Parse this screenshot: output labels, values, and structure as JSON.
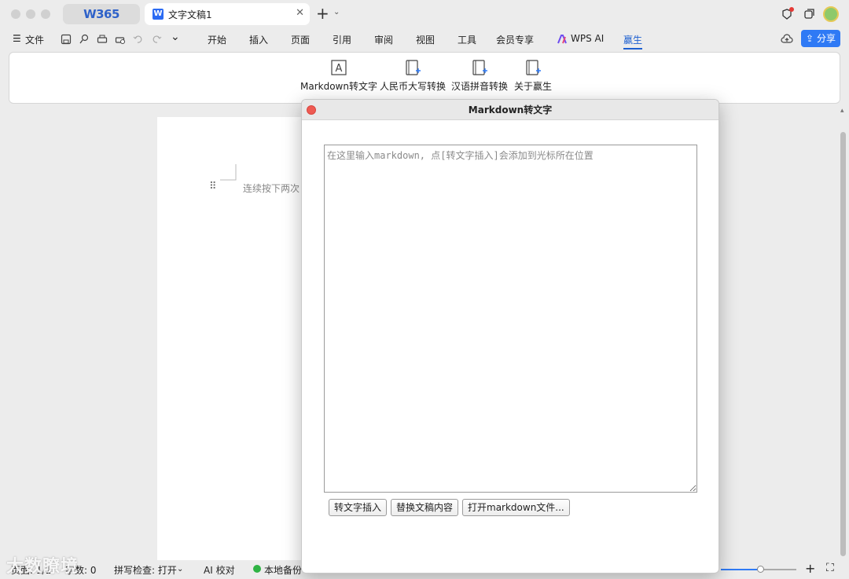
{
  "tabs": {
    "home_label": "W365",
    "doc_icon": "W",
    "doc_title": "文字文稿1"
  },
  "menu": {
    "file": "文件",
    "items": [
      "开始",
      "插入",
      "页面",
      "引用",
      "审阅",
      "视图",
      "工具",
      "会员专享",
      "WPS AI",
      "赢生"
    ],
    "share": "分享",
    "active_item": "赢生"
  },
  "ribbon": {
    "buttons": [
      {
        "label": "Markdown转文字",
        "icon": "text-box-icon"
      },
      {
        "label": "人民币大写转换",
        "icon": "doc-plus-icon"
      },
      {
        "label": "汉语拼音转换",
        "icon": "doc-plus-icon"
      },
      {
        "label": "关于赢生",
        "icon": "doc-plus-icon"
      }
    ]
  },
  "document": {
    "hint_text": "连续按下两次"
  },
  "dialog": {
    "title": "Markdown转文字",
    "placeholder": "在这里输入markdown, 点[转文字插入]会添加到光标所在位置",
    "btn_convert": "转文字插入",
    "btn_replace": "替换文稿内容",
    "btn_open": "打开markdown文件..."
  },
  "status": {
    "page": "页面: 1/1",
    "words": "字数: 0",
    "spell": "拼写检查: 打开",
    "ai_check": "AI 校对",
    "backup": "本地备份"
  },
  "watermark": "大数瞭境",
  "colors": {
    "accent": "#2f7af5",
    "close": "#ee5a52",
    "brand": "#2f62c9"
  }
}
